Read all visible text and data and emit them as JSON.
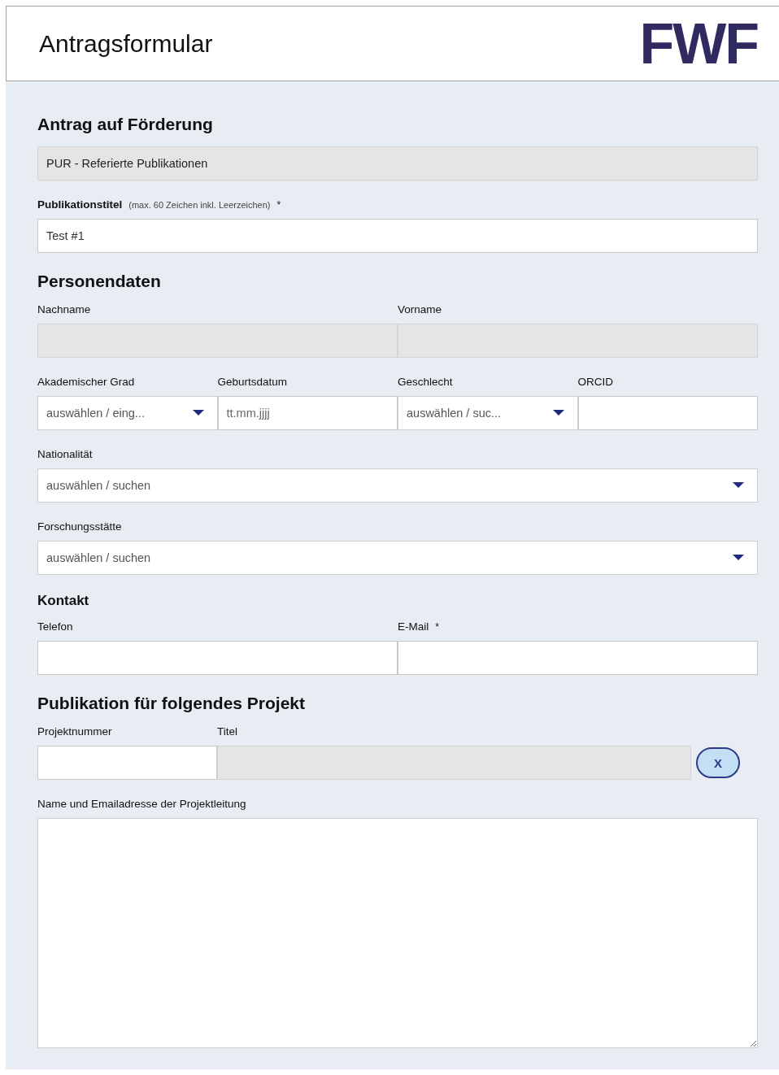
{
  "header": {
    "title": "Antragsformular",
    "logo": "FWF"
  },
  "blocks": [
    {
      "kind": "heading",
      "text": "Antrag auf Förderung"
    },
    {
      "kind": "row",
      "fields": [
        {
          "kind": "text",
          "disabled": true,
          "value": "PUR - Referierte Publikationen"
        }
      ]
    },
    {
      "kind": "row",
      "fields": [
        {
          "kind": "text",
          "disabled": false,
          "label": "Publikationstitel",
          "hint": "(max. 60 Zeichen inkl. Leerzeichen)",
          "marker": "*",
          "value": "Test #1"
        }
      ]
    },
    {
      "kind": "heading",
      "text": "Personendaten"
    },
    {
      "kind": "row",
      "fields": [
        {
          "kind": "text",
          "disabled": true,
          "label": "Nachname"
        },
        {
          "kind": "text",
          "disabled": true,
          "label": "Vorname"
        }
      ]
    },
    {
      "kind": "row",
      "fields": [
        {
          "kind": "select",
          "label": "Akademischer Grad",
          "placeholder": "auswählen / eing..."
        },
        {
          "kind": "text",
          "disabled": false,
          "label": "Geburtsdatum",
          "placeholder": "tt.mm.jjjj"
        },
        {
          "kind": "select",
          "label": "Geschlecht",
          "placeholder": "auswählen / suc..."
        },
        {
          "kind": "text",
          "disabled": false,
          "label": "ORCID"
        }
      ]
    },
    {
      "kind": "row",
      "fields": [
        {
          "kind": "select",
          "label": "Nationalität",
          "placeholder": "auswählen / suchen"
        }
      ]
    },
    {
      "kind": "row",
      "fields": [
        {
          "kind": "select",
          "label": "Forschungsstätte",
          "placeholder": "auswählen / suchen"
        }
      ]
    },
    {
      "kind": "subheading",
      "text": "Kontakt"
    },
    {
      "kind": "row",
      "fields": [
        {
          "kind": "text",
          "disabled": false,
          "label": "Telefon"
        },
        {
          "kind": "text",
          "disabled": false,
          "label": "E-Mail",
          "marker": "*"
        }
      ]
    },
    {
      "kind": "heading",
      "text": "Publikation für folgendes Projekt"
    },
    {
      "kind": "project",
      "fields": [
        {
          "kind": "text",
          "disabled": false,
          "label": "Projektnummer"
        },
        {
          "kind": "text",
          "disabled": true,
          "label": "Titel"
        }
      ],
      "button": "X"
    },
    {
      "kind": "textarea",
      "label": "Name und Emailadresse der Projektleitung"
    }
  ]
}
